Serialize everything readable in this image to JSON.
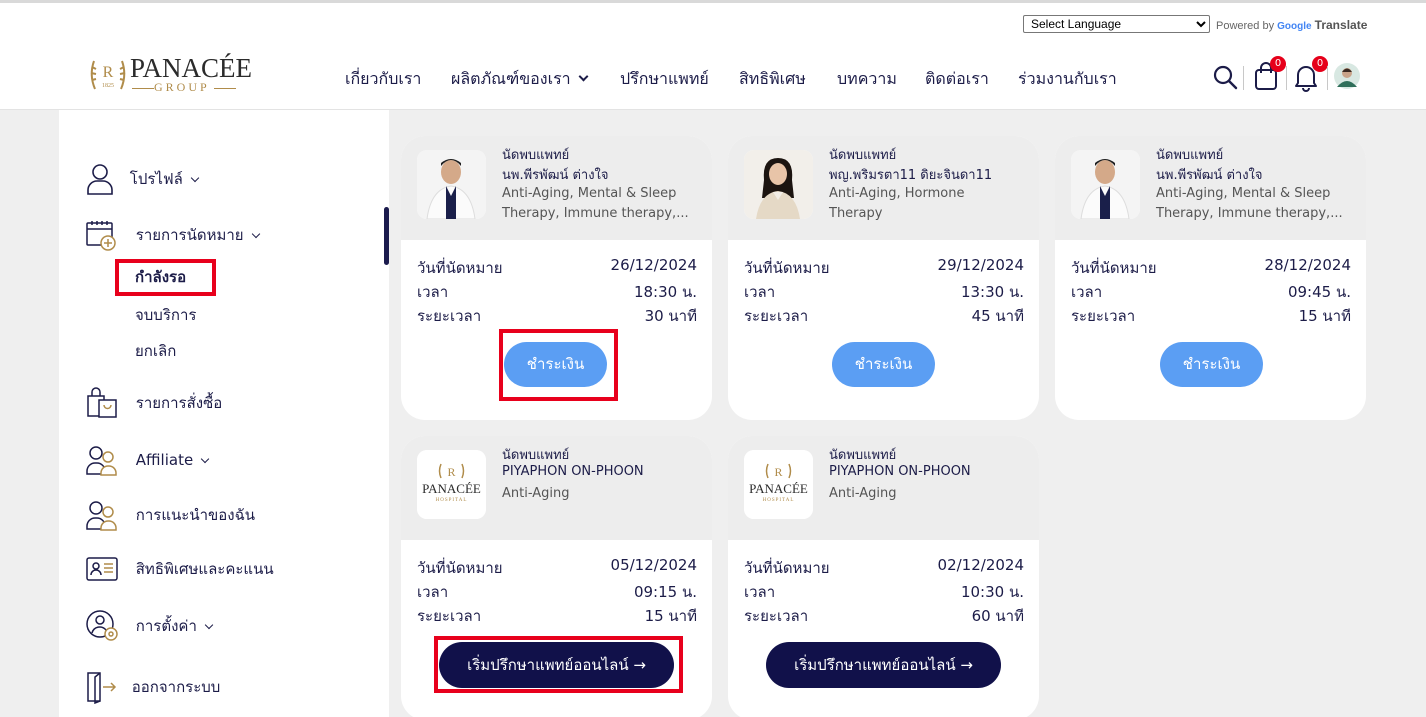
{
  "header": {
    "language_select": "Select Language",
    "powered_by": "Powered by",
    "google": "Google",
    "translate": "Translate",
    "logo_text": "PANACÉE",
    "logo_sub": "GROUP",
    "nav": [
      {
        "label": "เกี่ยวกับเรา"
      },
      {
        "label": "ผลิตภัณฑ์ของเรา"
      },
      {
        "label": "ปรึกษาแพทย์"
      },
      {
        "label": "สิทธิพิเศษ"
      },
      {
        "label": "บทความ"
      },
      {
        "label": "ติดต่อเรา"
      },
      {
        "label": "ร่วมงานกับเรา"
      }
    ],
    "cart_count": "0",
    "notification_count": "0"
  },
  "sidebar": {
    "profile": "โปรไฟล์",
    "appointments": "รายการนัดหมาย",
    "pending": "กำลังรอ",
    "completed": "จบบริการ",
    "cancelled": "ยกเลิก",
    "orders": "รายการสั่งซื้อ",
    "affiliate": "Affiliate",
    "referrals": "การแนะนำของฉัน",
    "privileges": "สิทธิพิเศษและคะแนน",
    "settings": "การตั้งค่า",
    "logout": "ออกจากระบบ"
  },
  "labels": {
    "date": "วันที่นัดหมาย",
    "time": "เวลา",
    "duration": "ระยะเวลา"
  },
  "cards": [
    {
      "tag": "นัดพบแพทย์",
      "doctor": "นพ.พีรพัฒน์ ต่างใจ",
      "spec1": "Anti-Aging, Mental & Sleep",
      "spec2": "Therapy, Immune therapy,...",
      "date": "26/12/2024",
      "time": "18:30 น.",
      "duration": "30 นาที",
      "button": "ชำระเงิน"
    },
    {
      "tag": "นัดพบแพทย์",
      "doctor": "พญ.พริมรตา11 ดิยะจินดา11",
      "spec1": "Anti-Aging, Hormone",
      "spec2": "Therapy",
      "date": "29/12/2024",
      "time": "13:30 น.",
      "duration": "45 นาที",
      "button": "ชำระเงิน"
    },
    {
      "tag": "นัดพบแพทย์",
      "doctor": "นพ.พีรพัฒน์ ต่างใจ",
      "spec1": "Anti-Aging, Mental & Sleep",
      "spec2": "Therapy, Immune therapy,...",
      "date": "28/12/2024",
      "time": "09:45 น.",
      "duration": "15 นาที",
      "button": "ชำระเงิน"
    },
    {
      "tag": "นัดพบแพทย์",
      "doctor": "PIYAPHON ON-PHOON",
      "spec1": "Anti-Aging",
      "spec2": "",
      "date": "05/12/2024",
      "time": "09:15 น.",
      "duration": "15 นาที",
      "button": "เริ่มปรึกษาแพทย์ออนไลน์ →"
    },
    {
      "tag": "นัดพบแพทย์",
      "doctor": "PIYAPHON ON-PHOON",
      "spec1": "Anti-Aging",
      "spec2": "",
      "date": "02/12/2024",
      "time": "10:30 น.",
      "duration": "60 นาที",
      "button": "เริ่มปรึกษาแพทย์ออนไลน์ →"
    }
  ],
  "hospital_logo": {
    "brand": "PANACÉE",
    "sub": "HOSPITAL"
  }
}
